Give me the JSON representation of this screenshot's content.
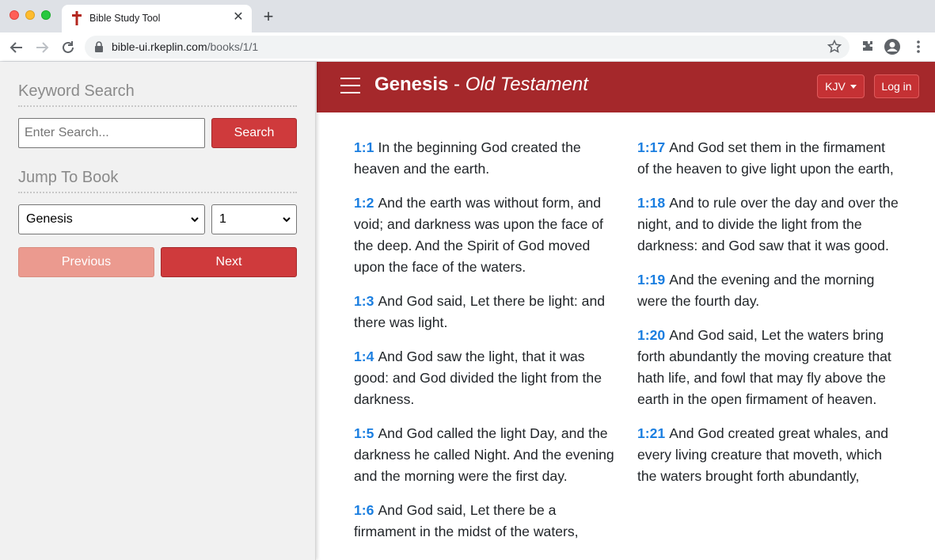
{
  "browser": {
    "tab_title": "Bible Study Tool",
    "url_host": "bible-ui.rkeplin.com",
    "url_path": "/books/1/1"
  },
  "sidebar": {
    "keyword_heading": "Keyword Search",
    "search_placeholder": "Enter Search...",
    "search_button": "Search",
    "jump_heading": "Jump To Book",
    "book_select": "Genesis",
    "chapter_select": "1",
    "previous_button": "Previous",
    "next_button": "Next"
  },
  "header": {
    "book": "Genesis",
    "separator": " - ",
    "testament": "Old Testament",
    "version_button": "KJV",
    "login_button": "Log in"
  },
  "colors": {
    "header_bg": "#a5282b",
    "accent_red": "#cf3a3c",
    "verse_ref_blue": "#1a7ee0"
  },
  "verses_left": [
    {
      "ref": "1:1",
      "text": "In the beginning God created the heaven and the earth."
    },
    {
      "ref": "1:2",
      "text": "And the earth was without form, and void; and darkness was upon the face of the deep. And the Spirit of God moved upon the face of the waters."
    },
    {
      "ref": "1:3",
      "text": "And God said, Let there be light: and there was light."
    },
    {
      "ref": "1:4",
      "text": "And God saw the light, that it was good: and God divided the light from the darkness."
    },
    {
      "ref": "1:5",
      "text": "And God called the light Day, and the darkness he called Night. And the evening and the morning were the first day."
    },
    {
      "ref": "1:6",
      "text": "And God said, Let there be a firmament in the midst of the waters,"
    }
  ],
  "verses_right": [
    {
      "ref": "1:17",
      "text": "And God set them in the firmament of the heaven to give light upon the earth,"
    },
    {
      "ref": "1:18",
      "text": "And to rule over the day and over the night, and to divide the light from the darkness: and God saw that it was good."
    },
    {
      "ref": "1:19",
      "text": "And the evening and the morning were the fourth day."
    },
    {
      "ref": "1:20",
      "text": "And God said, Let the waters bring forth abundantly the moving creature that hath life, and fowl that may fly above the earth in the open firmament of heaven."
    },
    {
      "ref": "1:21",
      "text": "And God created great whales, and every living creature that moveth, which the waters brought forth abundantly,"
    }
  ]
}
